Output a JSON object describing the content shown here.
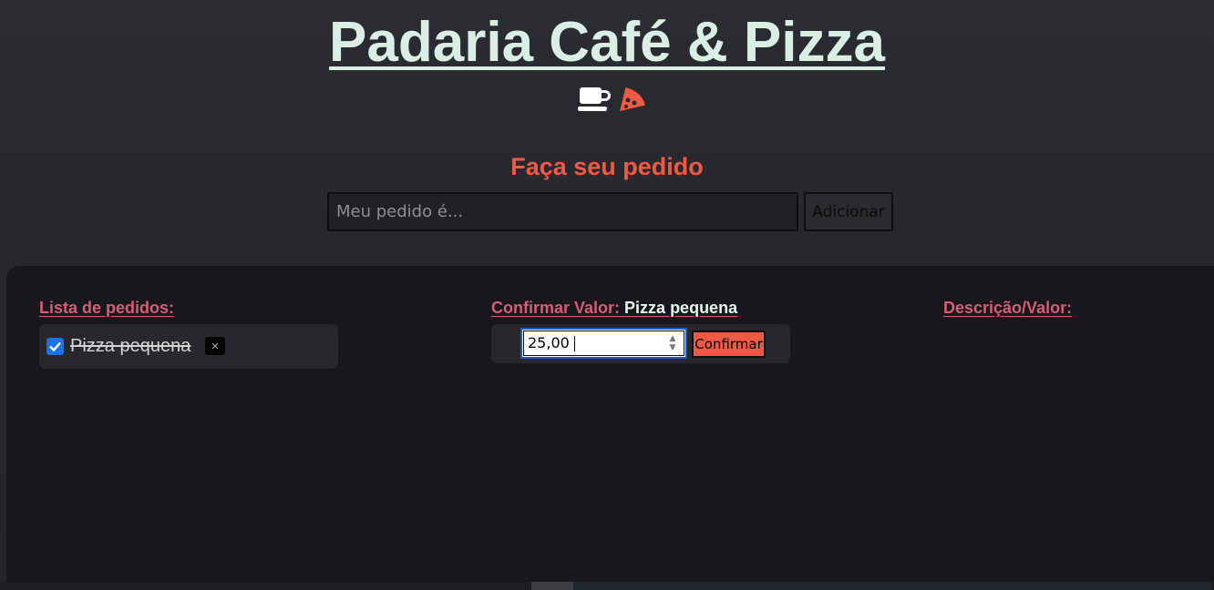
{
  "header": {
    "title": "Padaria Café & Pizza",
    "icons": [
      "coffee-cup-icon",
      "pizza-slice-icon"
    ]
  },
  "order": {
    "heading": "Faça seu pedido",
    "input_placeholder": "Meu pedido é...",
    "input_value": "",
    "add_label": "Adicionar"
  },
  "list": {
    "title": "Lista de pedidos:",
    "items": [
      {
        "label": "Pizza pequena",
        "checked": true,
        "remove_label": "✕"
      }
    ]
  },
  "confirm": {
    "title": "Confirmar Valor:",
    "item_name": "Pizza pequena",
    "value": "25,00",
    "confirm_label": "Confirmar"
  },
  "description": {
    "title": "Descrição/Valor:"
  },
  "colors": {
    "accent": "#f05a44",
    "title": "#d9efe4",
    "section_title": "#d75c77",
    "checkbox": "#1a73e8"
  }
}
